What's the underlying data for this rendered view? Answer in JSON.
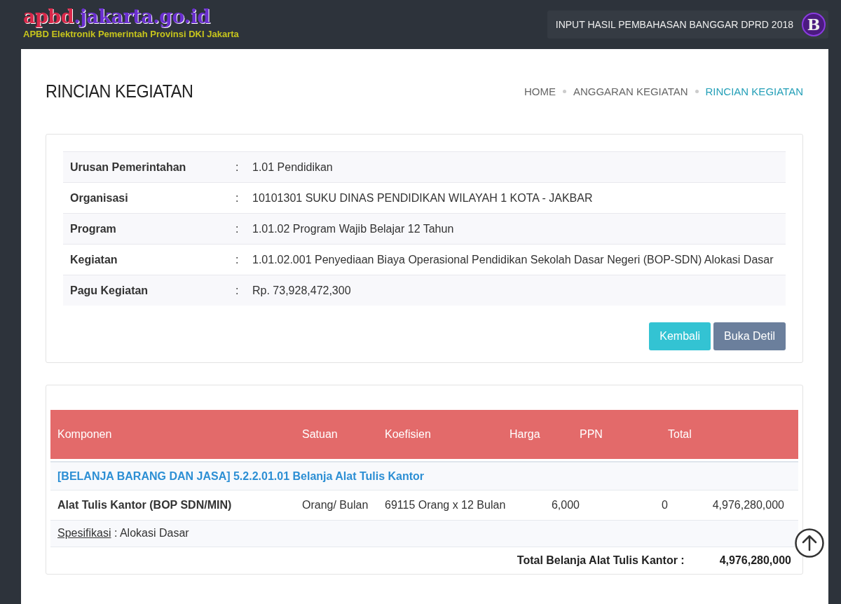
{
  "header": {
    "logo_parts": [
      {
        "text": "apbd",
        "color": "#d8284a"
      },
      {
        "text": ".jakarta.go.id",
        "color": "#6a2fd0"
      }
    ],
    "tagline": "APBD Elektronik Pemerintah Provinsi DKI Jakarta",
    "context": "INPUT HASIL PEMBAHASAN BANGGAR DPRD 2018",
    "avatar": "B"
  },
  "page_title": "RINCIAN KEGIATAN",
  "breadcrumb": [
    {
      "label": "HOME",
      "selected": false
    },
    {
      "label": "ANGGARAN KEGIATAN",
      "selected": false
    },
    {
      "label": "RINCIAN KEGIATAN",
      "selected": true
    }
  ],
  "details": [
    {
      "label": "Urusan Pemerintahan",
      "separator": ":",
      "value": "1.01 Pendidikan"
    },
    {
      "label": "Organisasi",
      "separator": ":",
      "value": "10101301 SUKU DINAS PENDIDIKAN WILAYAH 1 KOTA - JAKBAR"
    },
    {
      "label": "Program",
      "separator": ":",
      "value": "1.01.02 Program Wajib Belajar 12 Tahun"
    },
    {
      "label": "Kegiatan",
      "separator": ":",
      "value": "1.01.02.001 Penyediaan Biaya Operasional Pendidikan Sekolah Dasar Negeri (BOP-SDN) Alokasi Dasar"
    },
    {
      "label": "Pagu Kegiatan",
      "separator": ":",
      "value": "Rp. 73,928,472,300"
    }
  ],
  "buttons": [
    {
      "label": "Kembali",
      "kind": "info"
    },
    {
      "label": "Buka Detil",
      "kind": "secondary"
    }
  ],
  "table": {
    "columns": [
      "Komponen",
      "Satuan",
      "Koefisien",
      "Harga",
      "PPN",
      "Total"
    ],
    "group": "[BELANJA BARANG DAN JASA] 5.2.2.01.01 Belanja Alat Tulis Kantor",
    "rows": [
      {
        "komponen": "Alat Tulis Kantor (BOP SDN/MIN)",
        "satuan": "Orang/ Bulan",
        "koefisien": "69115 Orang x 12 Bulan",
        "harga": "6,000",
        "ppn": "0",
        "total": "4,976,280,000"
      }
    ],
    "spec": {
      "label": "Spesifikasi",
      "text": " : Alokasi Dasar"
    },
    "subtotal": {
      "label": "Total Belanja Alat Tulis Kantor :",
      "value": "4,976,280,000"
    }
  }
}
